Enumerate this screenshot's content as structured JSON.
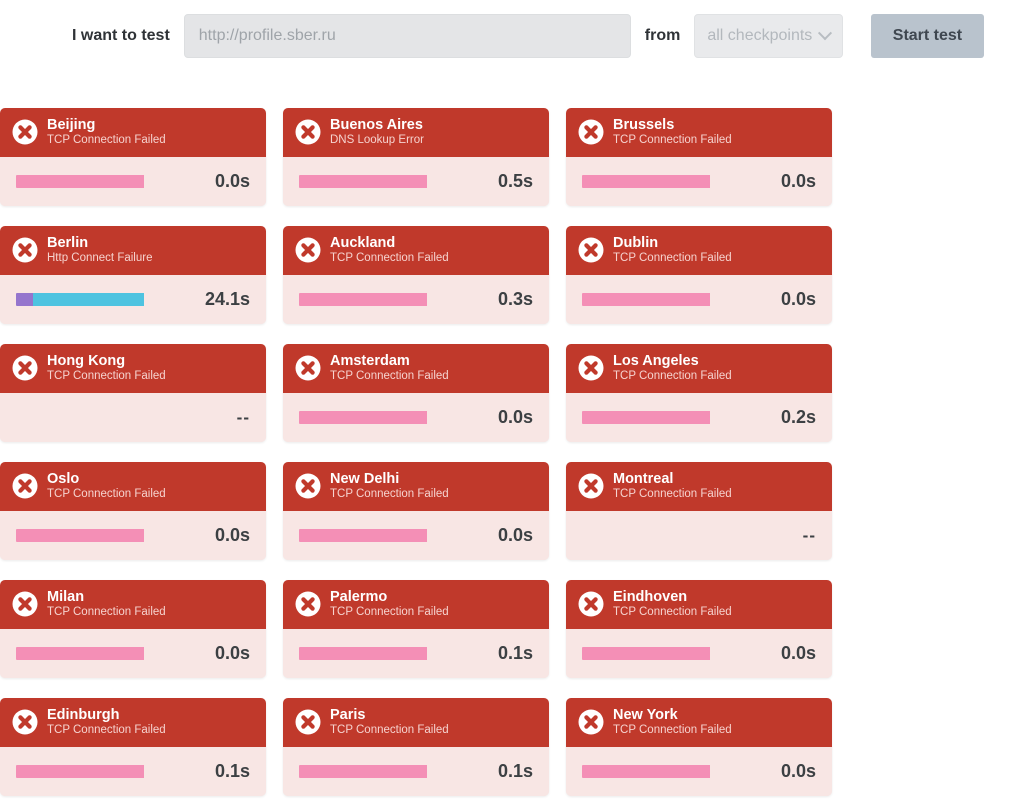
{
  "toolbar": {
    "label_left": "I want to test",
    "url_value": "",
    "url_placeholder": "http://profile.sber.ru",
    "label_from": "from",
    "checkpoint_selected": "all checkpoints",
    "checkpoint_icon": "chevron-down-icon",
    "start_button": "Start test",
    "colors": {
      "input_bg": "#e4e5e7",
      "select_bg": "#e9eaec",
      "button_bg": "#b9c3cd"
    }
  },
  "palette": {
    "card_header_red": "#c0392b",
    "card_body_pink": "#f8e6e4",
    "bar_pink": "#f48fb6",
    "bar_purple": "#9575cd",
    "bar_cyan": "#4ec3e0",
    "error_icon": "error-circle-x-icon"
  },
  "results": [
    [
      {
        "city": "Beijing",
        "status": "TCP Connection Failed",
        "time": "0.0s",
        "has_bar": true,
        "segments": [
          {
            "color": "#f48fb6",
            "pct": 100
          }
        ],
        "bar_width_pct": 72
      },
      {
        "city": "Buenos Aires",
        "status": "DNS Lookup Error",
        "time": "0.5s",
        "has_bar": true,
        "segments": [
          {
            "color": "#f48fb6",
            "pct": 100
          }
        ],
        "bar_width_pct": 72
      },
      {
        "city": "Brussels",
        "status": "TCP Connection Failed",
        "time": "0.0s",
        "has_bar": true,
        "segments": [
          {
            "color": "#f48fb6",
            "pct": 100
          }
        ],
        "bar_width_pct": 72
      }
    ],
    [
      {
        "city": "Berlin",
        "status": "Http Connect Failure",
        "time": "24.1s",
        "has_bar": true,
        "segments": [
          {
            "color": "#9575cd",
            "pct": 13
          },
          {
            "color": "#4ec3e0",
            "pct": 87
          }
        ],
        "bar_width_pct": 72
      },
      {
        "city": "Auckland",
        "status": "TCP Connection Failed",
        "time": "0.3s",
        "has_bar": true,
        "segments": [
          {
            "color": "#f48fb6",
            "pct": 100
          }
        ],
        "bar_width_pct": 72
      },
      {
        "city": "Dublin",
        "status": "TCP Connection Failed",
        "time": "0.0s",
        "has_bar": true,
        "segments": [
          {
            "color": "#f48fb6",
            "pct": 100
          }
        ],
        "bar_width_pct": 72
      }
    ],
    [
      {
        "city": "Hong Kong",
        "status": "TCP Connection Failed",
        "time": "--",
        "has_bar": false,
        "segments": [],
        "bar_width_pct": 0
      },
      {
        "city": "Amsterdam",
        "status": "TCP Connection Failed",
        "time": "0.0s",
        "has_bar": true,
        "segments": [
          {
            "color": "#f48fb6",
            "pct": 100
          }
        ],
        "bar_width_pct": 72
      },
      {
        "city": "Los Angeles",
        "status": "TCP Connection Failed",
        "time": "0.2s",
        "has_bar": true,
        "segments": [
          {
            "color": "#f48fb6",
            "pct": 100
          }
        ],
        "bar_width_pct": 72
      }
    ],
    [
      {
        "city": "Oslo",
        "status": "TCP Connection Failed",
        "time": "0.0s",
        "has_bar": true,
        "segments": [
          {
            "color": "#f48fb6",
            "pct": 100
          }
        ],
        "bar_width_pct": 72
      },
      {
        "city": "New Delhi",
        "status": "TCP Connection Failed",
        "time": "0.0s",
        "has_bar": true,
        "segments": [
          {
            "color": "#f48fb6",
            "pct": 100
          }
        ],
        "bar_width_pct": 72
      },
      {
        "city": "Montreal",
        "status": "TCP Connection Failed",
        "time": "--",
        "has_bar": false,
        "segments": [],
        "bar_width_pct": 0
      }
    ],
    [
      {
        "city": "Milan",
        "status": "TCP Connection Failed",
        "time": "0.0s",
        "has_bar": true,
        "segments": [
          {
            "color": "#f48fb6",
            "pct": 100
          }
        ],
        "bar_width_pct": 72
      },
      {
        "city": "Palermo",
        "status": "TCP Connection Failed",
        "time": "0.1s",
        "has_bar": true,
        "segments": [
          {
            "color": "#f48fb6",
            "pct": 100
          }
        ],
        "bar_width_pct": 72
      },
      {
        "city": "Eindhoven",
        "status": "TCP Connection Failed",
        "time": "0.0s",
        "has_bar": true,
        "segments": [
          {
            "color": "#f48fb6",
            "pct": 100
          }
        ],
        "bar_width_pct": 72
      }
    ],
    [
      {
        "city": "Edinburgh",
        "status": "TCP Connection Failed",
        "time": "0.1s",
        "has_bar": true,
        "segments": [
          {
            "color": "#f48fb6",
            "pct": 100
          }
        ],
        "bar_width_pct": 72
      },
      {
        "city": "Paris",
        "status": "TCP Connection Failed",
        "time": "0.1s",
        "has_bar": true,
        "segments": [
          {
            "color": "#f48fb6",
            "pct": 100
          }
        ],
        "bar_width_pct": 72
      },
      {
        "city": "New York",
        "status": "TCP Connection Failed",
        "time": "0.0s",
        "has_bar": true,
        "segments": [
          {
            "color": "#f48fb6",
            "pct": 100
          }
        ],
        "bar_width_pct": 72
      }
    ]
  ]
}
